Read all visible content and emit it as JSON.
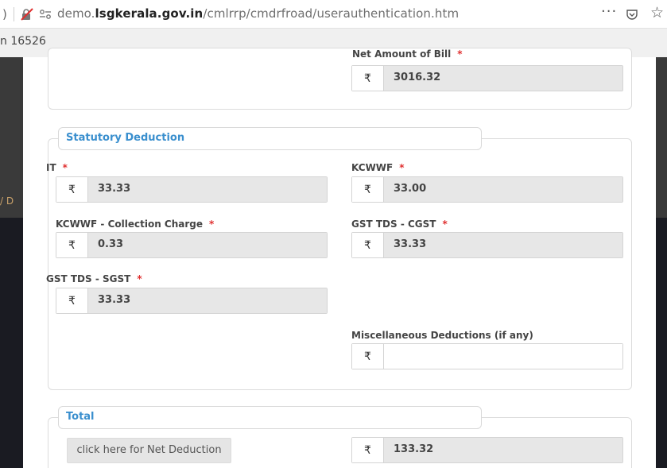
{
  "browser": {
    "edge_glyph": ")",
    "url_prefix": "demo.",
    "url_domain": "lsgkerala.gov.in",
    "url_path": "/cmlrrp/cmdrfroad/userauthentication.htm",
    "more_glyph": "···",
    "star_glyph": "☆",
    "icons": [
      "insecure-connection-icon",
      "permissions-icon",
      "more-icon",
      "pocket-icon",
      "star-icon"
    ]
  },
  "background": {
    "top_text": "n 16526",
    "side_text": "/ D"
  },
  "currency_symbol": "₹",
  "net_amount": {
    "label": "Net Amount of Bill",
    "required_mark": "*",
    "value": "3016.32"
  },
  "statutory": {
    "legend": "Statutory Deduction",
    "it": {
      "label": "IT",
      "required_mark": "*",
      "value": "33.33"
    },
    "kcwwf": {
      "label": "KCWWF",
      "required_mark": "*",
      "value": "33.00"
    },
    "kcwwf_collection": {
      "label": "KCWWF - Collection Charge",
      "required_mark": "*",
      "value": "0.33"
    },
    "gst_cgst": {
      "label": "GST TDS - CGST",
      "required_mark": "*",
      "value": "33.33"
    },
    "gst_sgst": {
      "label": "GST TDS - SGST",
      "required_mark": "*",
      "value": "33.33"
    },
    "misc": {
      "label": "Miscellaneous Deductions (if any)",
      "value": ""
    }
  },
  "total": {
    "legend": "Total",
    "button_label": "click here for Net Deduction",
    "value": "133.32"
  },
  "colors": {
    "legend_text": "#3a8fce",
    "required": "#e03030",
    "readonly_bg": "#e7e7e7",
    "backdrop": "#3a3a3a"
  }
}
